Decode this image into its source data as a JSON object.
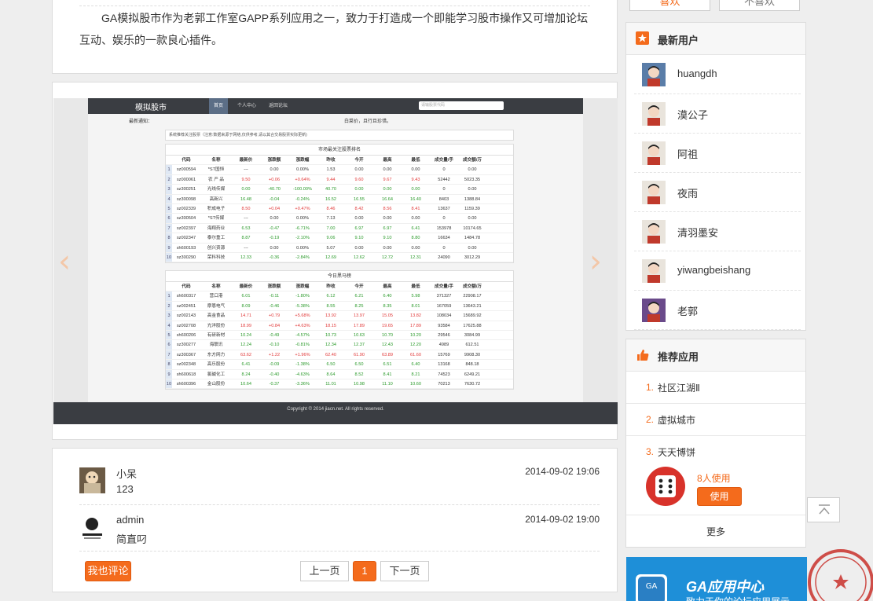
{
  "top_buttons": [
    "喜欢",
    "不喜欢"
  ],
  "intro": {
    "text": "GA模拟股市作为老郭工作室GAPP系列应用之一，致力于打造成一个即能学习股市操作又可增加论坛互动、娱乐的一款良心插件。"
  },
  "screenshot": {
    "logo": "模拟股市",
    "nav": [
      "首页",
      "个人中心",
      "返回论坛"
    ],
    "search_placeholder": "请输股票代码",
    "notice_label": "最新通知：",
    "notice_text": "白菜价，且行且珍惜。",
    "focus_text": "系统推荐关注股票（注意:数据来源于网络,仅供参考,请以其合交易股票实际更新)",
    "table1_title": "市场最关注股票排名",
    "table2_title": "今日黑马榜",
    "columns": [
      "",
      "代码",
      "名称",
      "最新价",
      "涨跌额",
      "涨跌幅",
      "昨收",
      "今开",
      "最高",
      "最低",
      "成交量/手",
      "成交额/万"
    ],
    "table1": [
      [
        "1",
        "sz000594",
        "*ST国恒",
        "---",
        "0.00",
        "0.00%",
        "1.53",
        "0.00",
        "0.00",
        "0.00",
        "0",
        "0.00",
        "flat"
      ],
      [
        "2",
        "sz000061",
        "农 产 品",
        "9.50",
        "+0.06",
        "+0.64%",
        "9.44",
        "9.60",
        "9.67",
        "9.43",
        "52442",
        "5023.35",
        "up"
      ],
      [
        "3",
        "sz300251",
        "光线传媒",
        "0.00",
        "-40.70",
        "-100.00%",
        "40.70",
        "0.00",
        "0.00",
        "0.00",
        "0",
        "0.00",
        "down"
      ],
      [
        "4",
        "sz300098",
        "高新兴",
        "16.48",
        "-0.04",
        "-0.24%",
        "16.52",
        "16.55",
        "16.64",
        "16.40",
        "8403",
        "1388.84",
        "down"
      ],
      [
        "5",
        "sz002339",
        "积成电子",
        "8.50",
        "+0.04",
        "+0.47%",
        "8.46",
        "8.42",
        "8.56",
        "8.41",
        "13637",
        "1159.39",
        "up"
      ],
      [
        "6",
        "sz300504",
        "*ST传媒",
        "---",
        "0.00",
        "0.00%",
        "7.13",
        "0.00",
        "0.00",
        "0.00",
        "0",
        "0.00",
        "flat"
      ],
      [
        "7",
        "sz002397",
        "海翔药业",
        "6.53",
        "-0.47",
        "-6.71%",
        "7.00",
        "6.97",
        "6.97",
        "6.41",
        "153978",
        "10174.65",
        "down"
      ],
      [
        "8",
        "sz002347",
        "泰尔重工",
        "8.87",
        "-0.19",
        "-2.10%",
        "9.06",
        "9.10",
        "9.10",
        "8.80",
        "16634",
        "1484.78",
        "down"
      ],
      [
        "9",
        "sh600193",
        "创兴资源",
        "---",
        "0.00",
        "0.00%",
        "5.07",
        "0.00",
        "0.00",
        "0.00",
        "0",
        "0.00",
        "flat"
      ],
      [
        "10",
        "sz300290",
        "荣科科技",
        "12.33",
        "-0.36",
        "-2.84%",
        "12.69",
        "12.62",
        "12.72",
        "12.31",
        "24090",
        "3012.29",
        "down"
      ]
    ],
    "table2": [
      [
        "1",
        "sh600317",
        "营口港",
        "6.01",
        "-0.11",
        "-1.80%",
        "6.12",
        "6.21",
        "6.40",
        "5.98",
        "371327",
        "22908.17",
        "down"
      ],
      [
        "2",
        "sz002451",
        "摩恩电气",
        "8.09",
        "-0.46",
        "-5.38%",
        "8.55",
        "8.25",
        "8.35",
        "8.01",
        "167059",
        "13643.21",
        "down"
      ],
      [
        "3",
        "sz002143",
        "高金食品",
        "14.71",
        "+0.79",
        "+5.68%",
        "13.92",
        "13.97",
        "15.05",
        "13.82",
        "108034",
        "15689.92",
        "up"
      ],
      [
        "4",
        "sz002708",
        "光洋股份",
        "18.99",
        "+0.84",
        "+4.63%",
        "18.15",
        "17.89",
        "19.65",
        "17.89",
        "93584",
        "17625.88",
        "up"
      ],
      [
        "5",
        "sh600206",
        "有研新材",
        "10.24",
        "-0.49",
        "-4.57%",
        "10.73",
        "10.63",
        "10.70",
        "10.20",
        "29546",
        "3084.99",
        "down"
      ],
      [
        "6",
        "sz300277",
        "海联讯",
        "12.24",
        "-0.10",
        "-0.81%",
        "12.34",
        "12.37",
        "12.43",
        "12.20",
        "4989",
        "612.51",
        "down"
      ],
      [
        "7",
        "sz300367",
        "东方网力",
        "63.62",
        "+1.22",
        "+1.96%",
        "62.40",
        "61.90",
        "63.89",
        "61.60",
        "15769",
        "9908.30",
        "up"
      ],
      [
        "8",
        "sz002348",
        "高乐股份",
        "6.41",
        "-0.09",
        "-1.38%",
        "6.50",
        "6.50",
        "6.51",
        "6.40",
        "13168",
        "848.18",
        "down"
      ],
      [
        "9",
        "sh600618",
        "氯碱化工",
        "8.24",
        "-0.40",
        "-4.63%",
        "8.64",
        "8.52",
        "8.41",
        "8.21",
        "74523",
        "6249.21",
        "down"
      ],
      [
        "10",
        "sh600396",
        "金山股份",
        "10.64",
        "-0.37",
        "-3.36%",
        "11.01",
        "10.98",
        "11.10",
        "10.60",
        "70213",
        "7630.72",
        "down"
      ]
    ],
    "copyright": "Copyright © 2014 jiacn.net. All rights reserved."
  },
  "comments": [
    {
      "name": "小呆",
      "text": "123",
      "time": "2014-09-02 19:06"
    },
    {
      "name": "admin",
      "text": "简直叼",
      "time": "2014-09-02 19:00"
    }
  ],
  "comment_button": "我也评论",
  "pagination": {
    "prev": "上一页",
    "current": "1",
    "next": "下一页"
  },
  "new_users": {
    "title": "最新用户",
    "users": [
      "huangdh",
      "漠公子",
      "阿祖",
      "夜雨",
      "清羽墨安",
      "yiwangbeishang",
      "老郭"
    ]
  },
  "recommended": {
    "title": "推荐应用",
    "apps": [
      {
        "num": "1.",
        "name": "社区江湖Ⅱ"
      },
      {
        "num": "2.",
        "name": "虚拟城市"
      },
      {
        "num": "3.",
        "name": "天天博饼"
      }
    ],
    "featured_users": "8人使用",
    "use_button": "使用",
    "more": "更多"
  },
  "banner": {
    "title": "GA应用中心",
    "subtitle": "致力于你的论坛应用展示"
  },
  "colors": {
    "accent": "#f46b1c",
    "up": "#e23a3a",
    "down": "#2a9a2a"
  }
}
